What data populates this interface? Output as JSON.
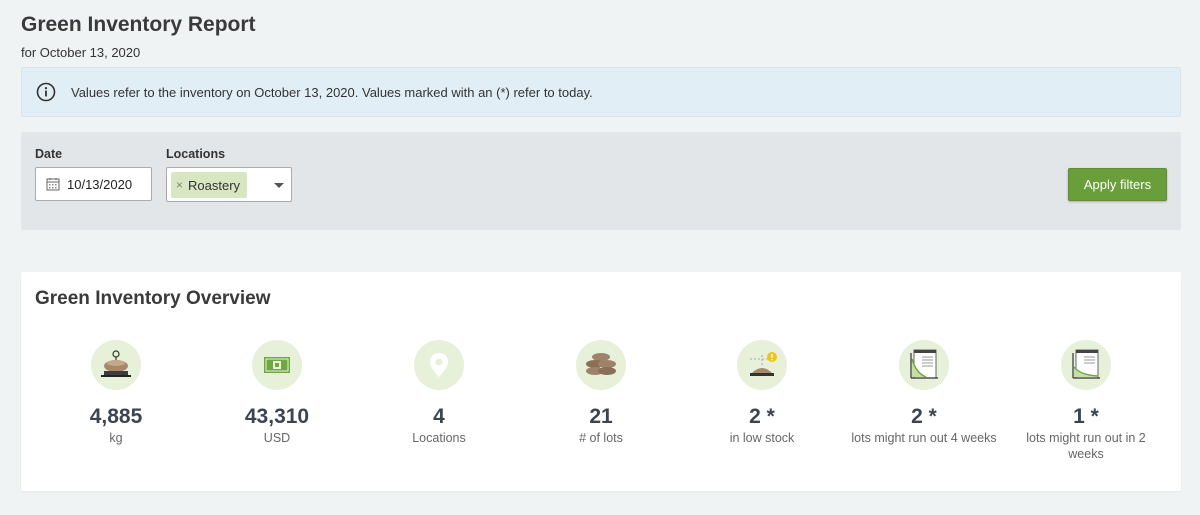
{
  "header": {
    "title": "Green Inventory Report",
    "subtitle": "for October 13, 2020"
  },
  "info_banner": {
    "icon": "info-icon",
    "text": "Values refer to the inventory on October 13, 2020. Values marked with an (*) refer to today."
  },
  "filters": {
    "date_label": "Date",
    "date_value": "10/13/2020",
    "locations_label": "Locations",
    "selected_location": "Roastery",
    "chip_remove": "×",
    "apply_label": "Apply filters",
    "colors": {
      "apply_button": "#6a9e3a",
      "chip": "#d9e6c3"
    }
  },
  "overview": {
    "title": "Green Inventory Overview",
    "stats": [
      {
        "value": "4,885",
        "label": "kg",
        "icon": "scale-icon"
      },
      {
        "value": "43,310",
        "label": "USD",
        "icon": "money-icon"
      },
      {
        "value": "4",
        "label": "Locations",
        "icon": "location-pin-icon"
      },
      {
        "value": "21",
        "label": "# of lots",
        "icon": "coffee-bags-icon"
      },
      {
        "value": "2 *",
        "label": "in low stock",
        "icon": "low-stock-icon"
      },
      {
        "value": "2 *",
        "label": "lots might run out 4 weeks",
        "icon": "runout-chart-icon"
      },
      {
        "value": "1 *",
        "label": "lots might run out in 2 weeks",
        "icon": "runout-chart-icon"
      }
    ]
  }
}
